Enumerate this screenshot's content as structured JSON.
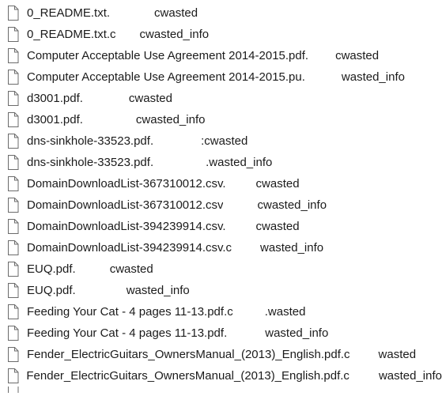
{
  "files": [
    {
      "name": "0_README.txt.",
      "suffix": "cwasted",
      "gap": 56
    },
    {
      "name": "0_README.txt.c",
      "suffix": "cwasted_info",
      "gap": 30
    },
    {
      "name": "Computer Acceptable Use Agreement 2014-2015.pdf.",
      "suffix": "cwasted",
      "gap": 34
    },
    {
      "name": "Computer Acceptable Use Agreement 2014-2015.pu.",
      "suffix": "wasted_info",
      "gap": 46
    },
    {
      "name": "d3001.pdf.",
      "suffix": "cwasted",
      "gap": 58
    },
    {
      "name": "d3001.pdf.",
      "suffix": "cwasted_info",
      "gap": 67
    },
    {
      "name": "dns-sinkhole-33523.pdf.",
      "suffix": ":cwasted",
      "gap": 60
    },
    {
      "name": "dns-sinkhole-33523.pdf.",
      "suffix": ".wasted_info",
      "gap": 66
    },
    {
      "name": "DomainDownloadList-367310012.csv.",
      "suffix": "cwasted",
      "gap": 38
    },
    {
      "name": "DomainDownloadList-367310012.csv",
      "suffix": "cwasted_info",
      "gap": 43
    },
    {
      "name": "DomainDownloadList-394239914.csv.",
      "suffix": "cwasted",
      "gap": 38
    },
    {
      "name": "DomainDownloadList-394239914.csv.c",
      "suffix": "wasted_info",
      "gap": 36
    },
    {
      "name": "EUQ.pdf.",
      "suffix": "cwasted",
      "gap": 43
    },
    {
      "name": "EUQ.pdf.",
      "suffix": "wasted_info",
      "gap": 64
    },
    {
      "name": "Feeding Your Cat - 4 pages 11-13.pdf.c",
      "suffix": ".wasted",
      "gap": 40
    },
    {
      "name": "Feeding Your Cat - 4 pages 11-13.pdf.",
      "suffix": "wasted_info",
      "gap": 48
    },
    {
      "name": "Fender_ElectricGuitars_OwnersManual_(2013)_English.pdf.c",
      "suffix": "wasted",
      "gap": 36
    },
    {
      "name": "Fender_ElectricGuitars_OwnersManual_(2013)_English.pdf.c",
      "suffix": "wasted_info",
      "gap": 38
    }
  ],
  "icon": "document-icon",
  "colors": {
    "icon_stroke": "#6b6b6b",
    "text": "#1b1b1b",
    "background": "#ffffff"
  }
}
